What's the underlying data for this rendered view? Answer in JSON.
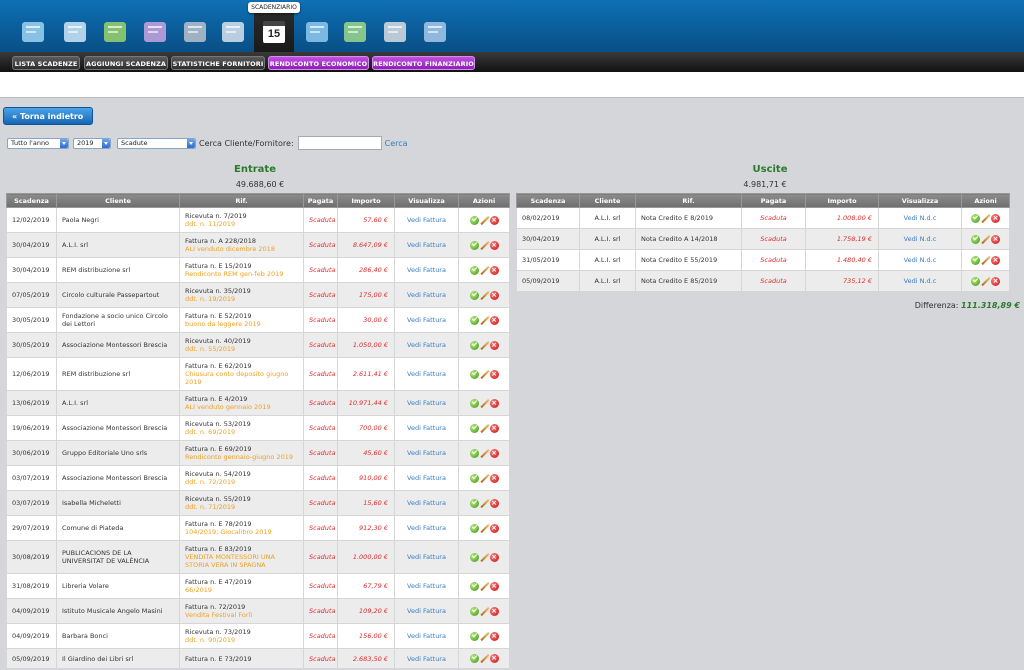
{
  "app": {
    "tooltip": "SCADENZIARIO",
    "calendar_day": "15"
  },
  "toolbar_icons": [
    "monitor-icon",
    "notepad-icon",
    "money-icon",
    "cart-icon",
    "box-icon",
    "invoice-icon",
    "calendar-icon",
    "pie-chart-icon",
    "globe-chart-icon",
    "tools-icon",
    "save-icon"
  ],
  "nav": [
    "LISTA SCADENZE",
    "AGGIUNGI SCADENZA",
    "STATISTICHE FORNITORI",
    "RENDICONTO ECONOMICO",
    "RENDICONTO FINANZIARIO"
  ],
  "back_label": "Torna indietro",
  "filters": {
    "period": "Tutto l'anno",
    "year": "2019",
    "status": "Scadute",
    "search_label": "Cerca Cliente/Fornitore:",
    "search_value": "",
    "search_button": "Cerca"
  },
  "headers_entrate": [
    "Scadenza",
    "Cliente",
    "Rif.",
    "Pagata",
    "Importo",
    "Visualizza",
    "Azioni"
  ],
  "headers_uscite": [
    "Scadenza",
    "Cliente",
    "Rif.",
    "Pagata",
    "Importo",
    "Visualizza",
    "Azioni"
  ],
  "entrate": {
    "title": "Entrate",
    "total": "49.688,60 €",
    "rows": [
      {
        "date": "12/02/2019",
        "client": "Paola Negri",
        "ref": "Ricevuta n. 7/2019",
        "ref2": "ddt. n. 11/2019",
        "paid": "Scaduta",
        "amount": "57,60 €",
        "view": "Vedi Fattura"
      },
      {
        "date": "30/04/2019",
        "client": "A.L.I. srl",
        "ref": "Fattura n. A 228/2018",
        "ref2": "ALI venduto dicembre 2018",
        "paid": "Scaduta",
        "amount": "8.647,09 €",
        "view": "Vedi Fattura"
      },
      {
        "date": "30/04/2019",
        "client": "REM distribuzione srl",
        "ref": "Fattura n. E 15/2019",
        "ref2": "Rendiconto REM gen-feb 2019",
        "paid": "Scaduta",
        "amount": "286,40 €",
        "view": "Vedi Fattura"
      },
      {
        "date": "07/05/2019",
        "client": "Circolo culturale Passepartout",
        "ref": "Ricevuta n. 35/2019",
        "ref2": "ddt. n. 19/2019",
        "paid": "Scaduta",
        "amount": "175,00 €",
        "view": "Vedi Fattura"
      },
      {
        "date": "30/05/2019",
        "client": "Fondazione a socio unico Circolo dei Lettori",
        "ref": "Fattura n. E 52/2019",
        "ref2": "buono da leggere 2019",
        "paid": "Scaduta",
        "amount": "30,00 €",
        "view": "Vedi Fattura"
      },
      {
        "date": "30/05/2019",
        "client": "Associazione Montessori Brescia",
        "ref": "Ricevuta n. 40/2019",
        "ref2": "ddt. n. 55/2019",
        "paid": "Scaduta",
        "amount": "1.050,00 €",
        "view": "Vedi Fattura"
      },
      {
        "date": "12/06/2019",
        "client": "REM distribuzione srl",
        "ref": "Fattura n. E 62/2019",
        "ref2": "Chiusura conto deposito giugno 2019",
        "paid": "Scaduta",
        "amount": "2.611,41 €",
        "view": "Vedi Fattura"
      },
      {
        "date": "13/06/2019",
        "client": "A.L.I. srl",
        "ref": "Fattura n. E 4/2019",
        "ref2": "ALI venduto gennaio 2019",
        "paid": "Scaduta",
        "amount": "10.971,44 €",
        "view": "Vedi Fattura"
      },
      {
        "date": "19/06/2019",
        "client": "Associazione Montessori Brescia",
        "ref": "Ricevuta n. 53/2019",
        "ref2": "ddt. n. 69/2019",
        "paid": "Scaduta",
        "amount": "700,00 €",
        "view": "Vedi Fattura"
      },
      {
        "date": "30/06/2019",
        "client": "Gruppo Editoriale Uno srls",
        "ref": "Fattura n. E 69/2019",
        "ref2": "Rendiconto gennaio-giugno 2019",
        "paid": "Scaduta",
        "amount": "45,60 €",
        "view": "Vedi Fattura"
      },
      {
        "date": "03/07/2019",
        "client": "Associazione Montessori Brescia",
        "ref": "Ricevuta n. 54/2019",
        "ref2": "ddt. n. 72/2019",
        "paid": "Scaduta",
        "amount": "910,00 €",
        "view": "Vedi Fattura"
      },
      {
        "date": "03/07/2019",
        "client": "Isabella Micheletti",
        "ref": "Ricevuta n. 55/2019",
        "ref2": "ddt. n. 71/2019",
        "paid": "Scaduta",
        "amount": "15,60 €",
        "view": "Vedi Fattura"
      },
      {
        "date": "29/07/2019",
        "client": "Comune di Piateda",
        "ref": "Fattura n. E 78/2019",
        "ref2": "104/2019; Giocalibro 2019",
        "paid": "Scaduta",
        "amount": "912,30 €",
        "view": "Vedi Fattura"
      },
      {
        "date": "30/08/2019",
        "client": "PUBLICACIONS DE LA UNIVERSITAT DE VALÈNCIA",
        "ref": "Fattura n. E 83/2019",
        "ref2": "VENDITA MONTESSORI UNA STORIA VERA IN SPAGNA",
        "paid": "Scaduta",
        "amount": "1.000,00 €",
        "view": "Vedi Fattura"
      },
      {
        "date": "31/08/2019",
        "client": "Libreria Volare",
        "ref": "Fattura n. E 47/2019",
        "ref2": "66/2019",
        "paid": "Scaduta",
        "amount": "67,79 €",
        "view": "Vedi Fattura"
      },
      {
        "date": "04/09/2019",
        "client": "Istituto Musicale Angelo Masini",
        "ref": "Fattura n. 72/2019",
        "ref2": "Vendita Festival Forlì",
        "paid": "Scaduta",
        "amount": "109,20 €",
        "view": "Vedi Fattura"
      },
      {
        "date": "04/09/2019",
        "client": "Barbara Bonci",
        "ref": "Ricevuta n. 73/2019",
        "ref2": "ddt. n. 90/2019",
        "paid": "Scaduta",
        "amount": "156,00 €",
        "view": "Vedi Fattura"
      },
      {
        "date": "05/09/2019",
        "client": "Il Giardino dei Libri srl",
        "ref": "Fattura n. E 73/2019",
        "ref2": "",
        "paid": "Scaduta",
        "amount": "2.683,50 €",
        "view": "Vedi Fattura"
      }
    ]
  },
  "uscite": {
    "title": "Uscite",
    "total": "4.981,71 €",
    "rows": [
      {
        "date": "08/02/2019",
        "client": "A.L.I. srl",
        "ref": "Nota Credito E 8/2019",
        "paid": "Scaduta",
        "amount": "1.008,00 €",
        "view": "Vedi N.d.c"
      },
      {
        "date": "30/04/2019",
        "client": "A.L.I. srl",
        "ref": "Nota Credito A 14/2018",
        "paid": "Scaduta",
        "amount": "1.758,19 €",
        "view": "Vedi N.d.c"
      },
      {
        "date": "31/05/2019",
        "client": "A.L.I. srl",
        "ref": "Nota Credito E 55/2019",
        "paid": "Scaduta",
        "amount": "1.480,40 €",
        "view": "Vedi N.d.c"
      },
      {
        "date": "05/09/2019",
        "client": "A.L.I. srl",
        "ref": "Nota Credito E 85/2019",
        "paid": "Scaduta",
        "amount": "735,12 €",
        "view": "Vedi N.d.c"
      }
    ]
  },
  "difference": {
    "label": "Differenza:",
    "value": "111.318,89 €"
  }
}
